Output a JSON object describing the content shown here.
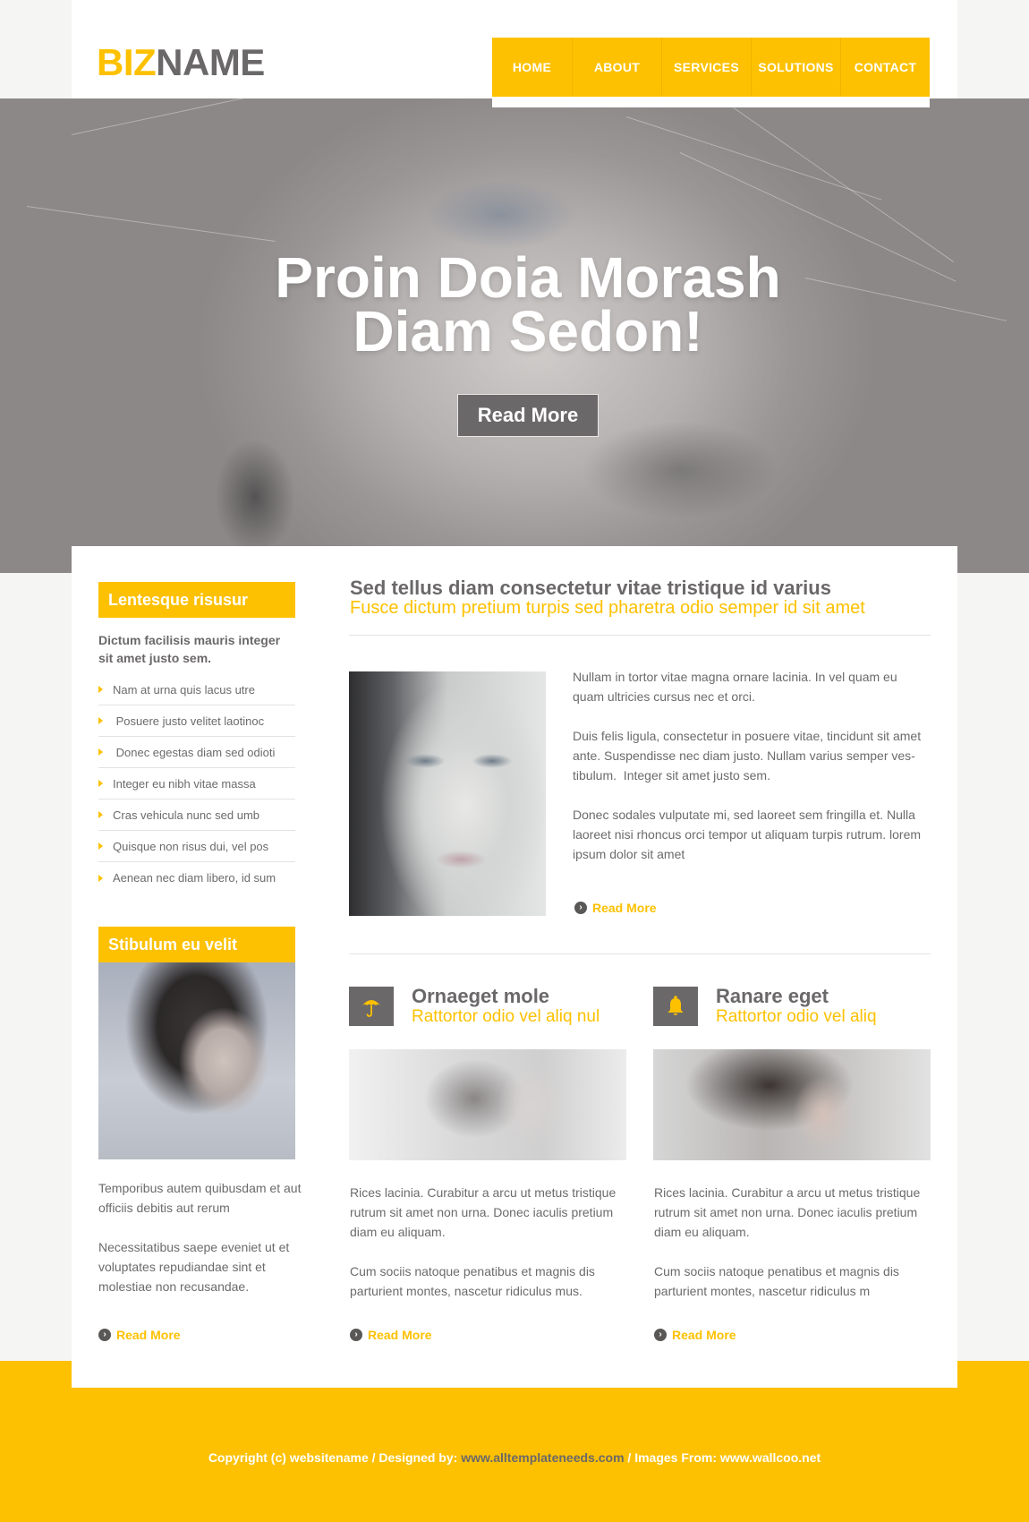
{
  "header": {
    "logo_part1": "BIZ",
    "logo_part2": "NAME",
    "nav": [
      "HOME",
      "ABOUT",
      "SERVICES",
      "SOLUTIONS",
      "CONTACT"
    ]
  },
  "hero": {
    "title_line1": "Proin Doia  Morash",
    "title_line2": "Diam Sedon!",
    "button": "Read More"
  },
  "sidebar": {
    "box1_title": "Lentesque risusur",
    "intro": "Dictum facilisis mauris integer sit amet justo sem.",
    "items": [
      "Nam at urna quis lacus utre",
      " Posuere justo velitet laotinoc",
      " Donec egestas diam sed odioti",
      "Integer eu nibh vitae massa",
      "Cras vehicula nunc sed umb",
      "Quisque non risus dui, vel pos",
      "Aenean nec diam libero, id sum"
    ],
    "box2_title": "Stibulum eu velit",
    "para1": "Temporibus autem quibusdam et aut officiis debitis aut rerum",
    "para2": "Necessitatibus saepe eveniet ut et voluptates repudiandae sint et molestiae non recusandae.",
    "read_more": "Read More"
  },
  "content": {
    "title": "Sed tellus diam consectetur vitae tristique id varius",
    "subtitle": "Fusce dictum pretium turpis sed pharetra odio semper id sit amet",
    "para1": "Nullam in tortor vitae magna ornare lacinia. In vel quam eu quam ultricies cursus nec et orci.",
    "para2_line1": "Duis felis ligula, consectetur in posuere vitae, tincidunt sit amet",
    "para2_line2": "ante. Suspendisse nec diam justo. Nullam varius semper ves-",
    "para2_line3": "tibulum.  Integer sit amet justo sem.",
    "para3": "Donec sodales vulputate mi, sed laoreet sem fringilla et. Nulla laoreet nisi rhoncus orci tempor ut aliquam turpis rutrum. lorem ipsum dolor sit amet",
    "read_more": "Read More"
  },
  "columns": [
    {
      "icon": "umbrella-icon",
      "title": "Ornaeget mole",
      "subtitle": "Rattortor odio vel aliq nul",
      "para1": "Rices lacinia. Curabitur a arcu ut metus tristique rutrum sit amet non urna. Donec iaculis pretium diam eu aliquam.",
      "para2": "Cum sociis natoque penatibus et magnis dis parturient montes, nascetur ridiculus mus.",
      "read_more": "Read More"
    },
    {
      "icon": "bell-icon",
      "title": "Ranare eget",
      "subtitle": "Rattortor odio vel aliq",
      "para1": "Rices lacinia. Curabitur a arcu ut metus tristique rutrum sit amet non urna. Donec iaculis pretium diam eu aliquam.",
      "para2": "Cum sociis natoque penatibus et magnis dis parturient montes, nascetur ridiculus m",
      "read_more": "Read More"
    }
  ],
  "footer": {
    "text1": "Copyright (c) websitename / Designed by: ",
    "link1": "www.alltemplateneeds.com",
    "text2": " / Images From: ",
    "link2": "www.wallcoo.net"
  },
  "colors": {
    "accent": "#fdc101",
    "dark_gray": "#6b6869",
    "text_gray": "#6b6b6b",
    "background": "#f5f5f4"
  }
}
